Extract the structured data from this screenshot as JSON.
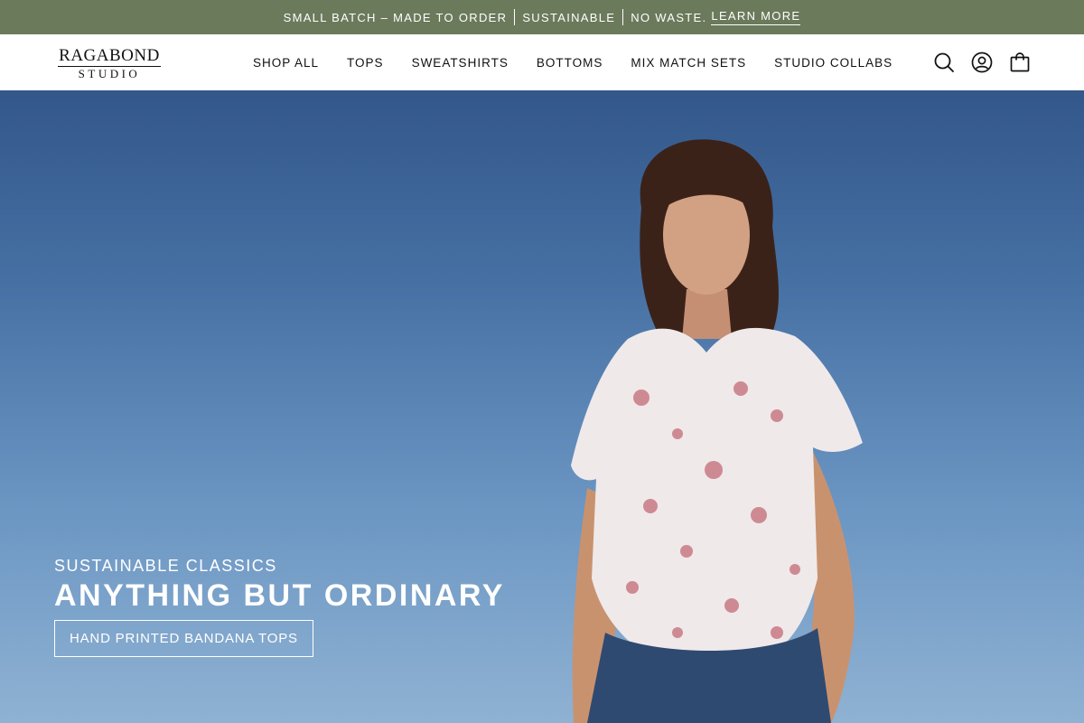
{
  "announcement": {
    "segment1": "SMALL BATCH – MADE TO ORDER",
    "segment2": "SUSTAINABLE",
    "segment3": "NO WASTE.",
    "link": "LEARN MORE",
    "background": "#6b7a5b"
  },
  "header": {
    "logo_line1": "RAGABOND",
    "logo_line2": "STUDIO",
    "nav": [
      "SHOP ALL",
      "TOPS",
      "SWEATSHIRTS",
      "BOTTOMS",
      "MIX MATCH SETS",
      "STUDIO COLLABS"
    ],
    "icons": [
      "search-icon",
      "account-icon",
      "bag-icon"
    ]
  },
  "hero": {
    "eyebrow": "SUSTAINABLE CLASSICS",
    "headline": "ANYTHING BUT ORDINARY",
    "cta": "HAND PRINTED BANDANA TOPS",
    "sky_top": "#33578a",
    "sky_bottom": "#8fb2d3"
  }
}
